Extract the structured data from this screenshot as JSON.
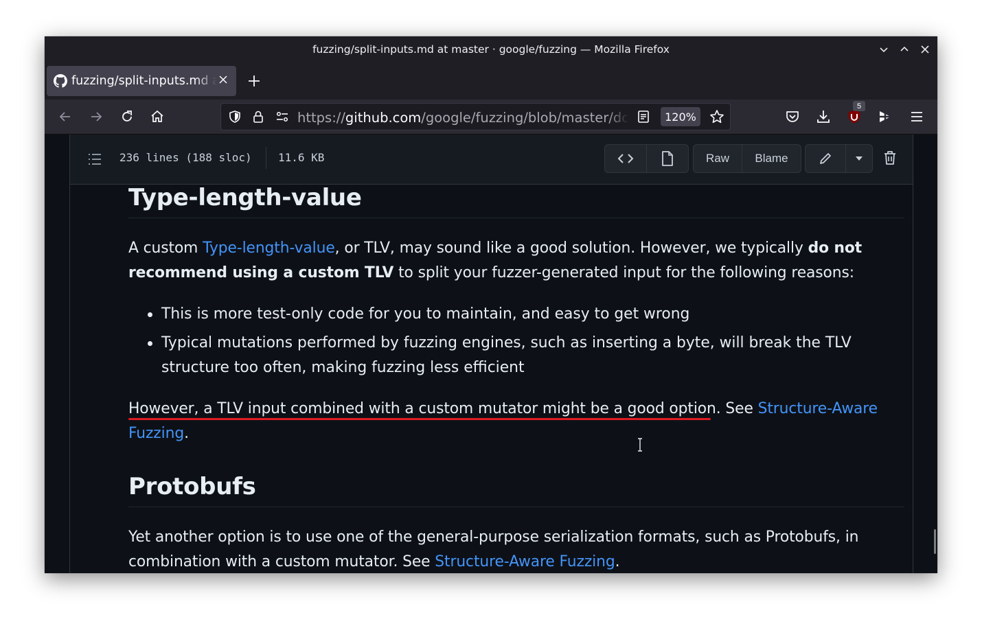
{
  "window": {
    "title": "fuzzing/split-inputs.md at master · google/fuzzing — Mozilla Firefox"
  },
  "tabs": [
    {
      "label": "fuzzing/split-inputs.md at master · google/fuzzing",
      "active": true
    }
  ],
  "navbar": {
    "url_scheme": "https://",
    "url_host": "github.com",
    "url_path": "/google/fuzzing/blob/master/docs/split-inputs.md",
    "zoom": "120%",
    "extension_badge": "5"
  },
  "file_header": {
    "lines": "236 lines (188 sloc)",
    "size": "11.6 KB",
    "raw_label": "Raw",
    "blame_label": "Blame"
  },
  "article": {
    "h_tlv": "Type-length-value",
    "p1_a": "A custom ",
    "p1_link": "Type-length-value",
    "p1_b": ", or TLV, may sound like a good solution. However, we typically ",
    "p1_bold": "do not recommend using a custom TLV",
    "p1_c": " to split your fuzzer-generated input for the following reasons:",
    "bullets": [
      "This is more test-only code for you to maintain, and easy to get wrong",
      "Typical mutations performed by fuzzing engines, such as inserting a byte, will break the TLV structure too often, making fuzzing less efficient"
    ],
    "p2_a": "However, a TLV input combined with a custom mutator might be a good option.",
    "p2_b": " See ",
    "p2_link": "Structure-Aware Fuzzing",
    "p2_end": ".",
    "h_proto": "Protobufs",
    "p3_a": "Yet another option is to use one of the general-purpose serialization formats, such as Protobufs, in combination with a custom mutator. See ",
    "p3_link": "Structure-Aware Fuzzing",
    "p3_end": "."
  },
  "colors": {
    "accent_link": "#4493f8",
    "annotation_underline": "#e01b24",
    "page_bg": "#0d1117"
  }
}
